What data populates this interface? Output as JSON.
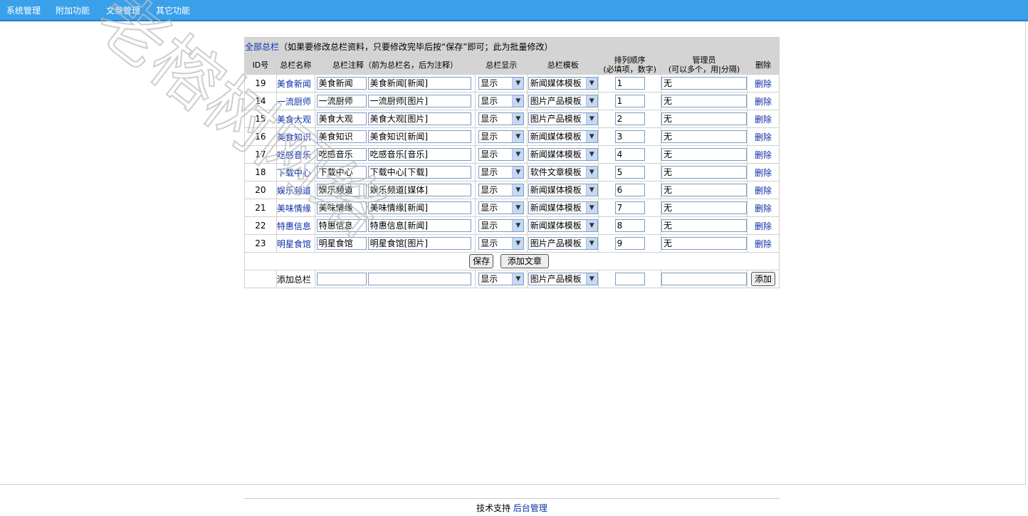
{
  "nav": [
    "系统管理",
    "附加功能",
    "文章管理",
    "其它功能"
  ],
  "caption": {
    "link": "全部总栏",
    "note": "（如果要修改总栏资料，只要修改完毕后按“保存”即可；此为批量修改）"
  },
  "headers": [
    "ID号",
    "总栏名称",
    "总栏注释（前为总栏名，后为注释）",
    "总栏显示",
    "总栏模板",
    "排列顺序",
    "(必填项，数字)",
    "管理员",
    "(可以多个，用|分隔)",
    "删除"
  ],
  "rows": [
    {
      "id": "19",
      "name": "美食新闻",
      "short": "美食新闻",
      "note": "美食新闻[新闻]",
      "show": "显示",
      "tpl": "新闻媒体模板",
      "order": "1",
      "admin": "无",
      "del": "删除"
    },
    {
      "id": "14",
      "name": "一流厨师",
      "short": "一流厨师",
      "note": "一流厨师[图片]",
      "show": "显示",
      "tpl": "图片产品模板",
      "order": "1",
      "admin": "无",
      "del": "删除"
    },
    {
      "id": "15",
      "name": "美食大观",
      "short": "美食大观",
      "note": "美食大观[图片]",
      "show": "显示",
      "tpl": "图片产品模板",
      "order": "2",
      "admin": "无",
      "del": "删除"
    },
    {
      "id": "16",
      "name": "美食知识",
      "short": "美食知识",
      "note": "美食知识[新闻]",
      "show": "显示",
      "tpl": "新闻媒体模板",
      "order": "3",
      "admin": "无",
      "del": "删除"
    },
    {
      "id": "17",
      "name": "吃感音乐",
      "short": "吃感音乐",
      "note": "吃感音乐[音乐]",
      "show": "显示",
      "tpl": "新闻媒体模板",
      "order": "4",
      "admin": "无",
      "del": "删除"
    },
    {
      "id": "18",
      "name": "下载中心",
      "short": "下载中心",
      "note": "下载中心[下载]",
      "show": "显示",
      "tpl": "软件文章模板",
      "order": "5",
      "admin": "无",
      "del": "删除"
    },
    {
      "id": "20",
      "name": "娱乐频道",
      "short": "娱乐频道",
      "note": "娱乐频道[媒体]",
      "show": "显示",
      "tpl": "新闻媒体模板",
      "order": "6",
      "admin": "无",
      "del": "删除"
    },
    {
      "id": "21",
      "name": "美味情缘",
      "short": "美味情缘",
      "note": "美味情缘[新闻]",
      "show": "显示",
      "tpl": "新闻媒体模板",
      "order": "7",
      "admin": "无",
      "del": "删除"
    },
    {
      "id": "22",
      "name": "特惠信息",
      "short": "特惠信息",
      "note": "特惠信息[新闻]",
      "show": "显示",
      "tpl": "新闻媒体模板",
      "order": "8",
      "admin": "无",
      "del": "删除"
    },
    {
      "id": "23",
      "name": "明星食馆",
      "short": "明星食馆",
      "note": "明星食馆[图片]",
      "show": "显示",
      "tpl": "图片产品模板",
      "order": "9",
      "admin": "无",
      "del": "删除"
    }
  ],
  "actions": {
    "save": "保存",
    "add_article": "添加文章"
  },
  "add_row": {
    "label": "添加总栏",
    "show": "显示",
    "tpl": "图片产品模板",
    "add": "添加"
  },
  "footer": {
    "text": "技术支持",
    "link": "后台管理"
  },
  "watermark": "老榕树网络"
}
